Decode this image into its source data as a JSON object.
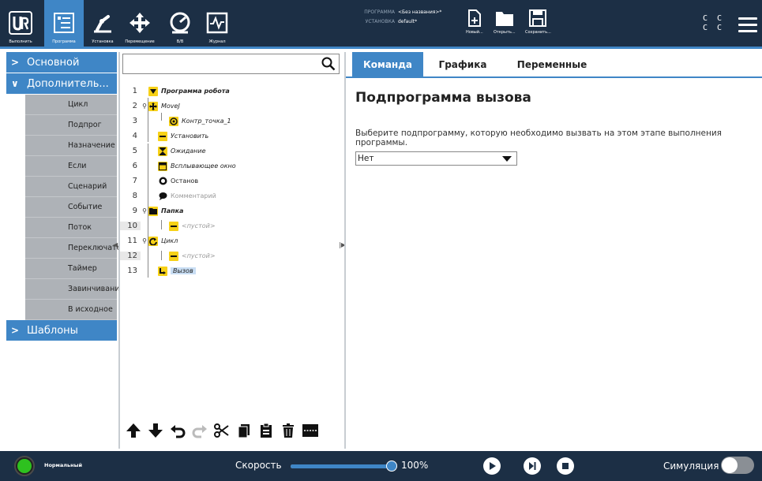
{
  "nav": {
    "run_label": "Выполнить",
    "program_label": "Программа",
    "installation_label": "Установка",
    "move_label": "Перемещение",
    "io_label": "В/В",
    "log_label": "Журнал"
  },
  "program_info": {
    "program_key": "ПРОГРАММА",
    "program_value": "<Без названия>*",
    "installation_key": "УСТАНОВКА",
    "installation_value": "default*"
  },
  "file_actions": {
    "new_label": "Новый...",
    "open_label": "Открыть...",
    "save_label": "Сохранить..."
  },
  "top_right": {
    "line1": "C C",
    "line2": "C C"
  },
  "sidebar": {
    "basic_label": "Основной",
    "advanced_label": "Дополнитель...",
    "advanced_items": [
      "Цикл",
      "Подпрог",
      "Назначение",
      "Если",
      "Сценарий",
      "Событие",
      "Поток",
      "Переключатель",
      "Таймер",
      "Завинчивание",
      "В исходное"
    ],
    "templates_label": "Шаблоны"
  },
  "tree": {
    "rows": [
      {
        "num": "1",
        "text": "Программа робота"
      },
      {
        "num": "2",
        "text": "MoveJ"
      },
      {
        "num": "3",
        "text": "Контр_точка_1"
      },
      {
        "num": "4",
        "text": "Установить"
      },
      {
        "num": "5",
        "text": "Ожидание"
      },
      {
        "num": "6",
        "text": "Всплывающее окно"
      },
      {
        "num": "7",
        "text": "Останов"
      },
      {
        "num": "8",
        "text": "Комментарий"
      },
      {
        "num": "9",
        "text": "Папка"
      },
      {
        "num": "10",
        "text": "<пустой>"
      },
      {
        "num": "11",
        "text": "Цикл"
      },
      {
        "num": "12",
        "text": "<пустой>"
      },
      {
        "num": "13",
        "text": "Вызов"
      }
    ]
  },
  "tabs": [
    "Команда",
    "Графика",
    "Переменные"
  ],
  "panel": {
    "title": "Подпрограмма вызова",
    "instruction": "Выберите подпрограмму, которую необходимо вызвать на этом этапе выполнения программы.",
    "select_value": "Нет"
  },
  "bottom": {
    "status": "Нормальный",
    "speed_label": "Скорость",
    "speed_value": "100%",
    "speed_fraction": 1.0,
    "sim_label": "Симуляция"
  },
  "colors": {
    "header_bg": "#1c2f45",
    "accent": "#3f86c6",
    "node_yellow": "#f7d117",
    "status_green": "#2ec11f"
  }
}
